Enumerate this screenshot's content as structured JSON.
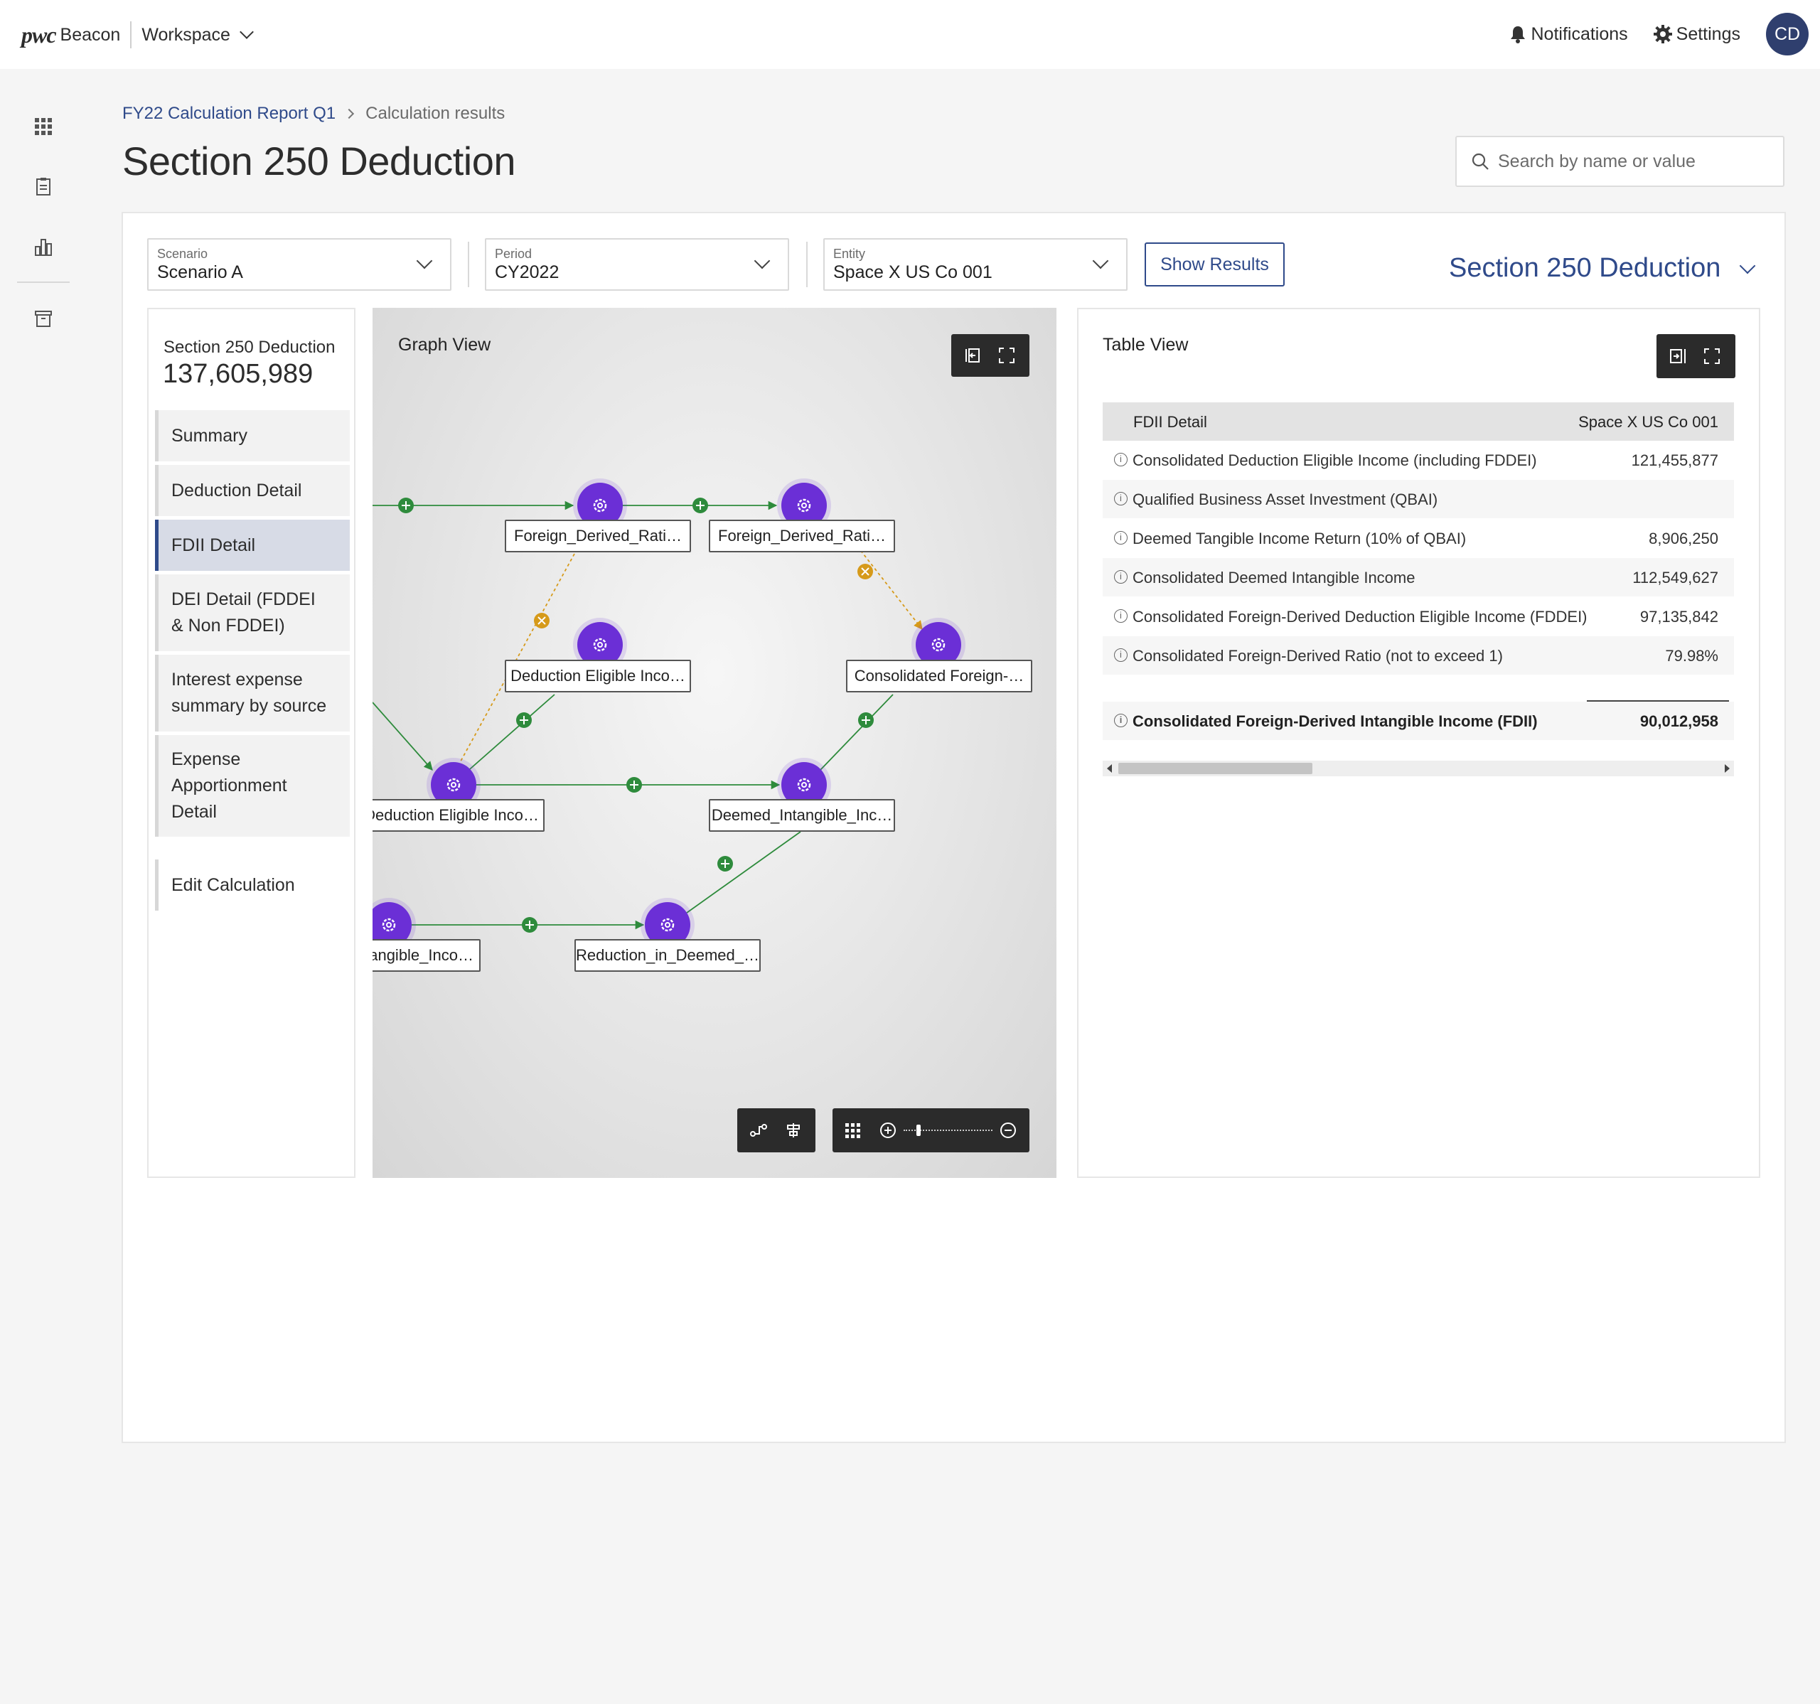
{
  "brand": {
    "logo": "pwc",
    "product": "Beacon",
    "workspace": "Workspace"
  },
  "topnav": {
    "notifications": "Notifications",
    "settings": "Settings",
    "avatar_initials": "CD"
  },
  "breadcrumb": {
    "parent": "FY22 Calculation Report Q1",
    "current": "Calculation results"
  },
  "page_title": "Section 250 Deduction",
  "search": {
    "placeholder": "Search by name or value",
    "value": ""
  },
  "filters": {
    "scenario": {
      "label": "Scenario",
      "value": "Scenario A"
    },
    "period": {
      "label": "Period",
      "value": "CY2022"
    },
    "entity": {
      "label": "Entity",
      "value": "Space X US Co 001"
    },
    "show_results": "Show Results"
  },
  "section_selector": "Section 250 Deduction",
  "nav": {
    "head": "Section 250 Deduction",
    "total": "137,605,989",
    "items": [
      {
        "label": "Summary"
      },
      {
        "label": "Deduction Detail"
      },
      {
        "label": "FDII Detail",
        "active": true
      },
      {
        "label": "DEI Detail (FDDEI & Non FDDEI)"
      },
      {
        "label": "Interest expense summary by source"
      },
      {
        "label": "Expense Apportionment Detail"
      },
      {
        "label": "Edit Calculation"
      }
    ]
  },
  "graph": {
    "title": "Graph View",
    "nodes": [
      {
        "label": "Foreign_Derived_Rati…"
      },
      {
        "label": "Foreign_Derived_Rati…"
      },
      {
        "label": "Deduction Eligible Inco…"
      },
      {
        "label": "Consolidated Foreign-…"
      },
      {
        "label": "Deduction Eligible Inco…"
      },
      {
        "label": "Deemed_Intangible_Inc…"
      },
      {
        "label": "angible_Inco…"
      },
      {
        "label": "Reduction_in_Deemed_…"
      }
    ],
    "zoom_level": 0.15
  },
  "table": {
    "title": "Table View",
    "header": {
      "label": "FDII Detail",
      "column": "Space X US Co 001"
    },
    "rows": [
      {
        "label": "Consolidated Deduction Eligible Income (including FDDEI)",
        "value": "121,455,877"
      },
      {
        "label": "Qualified Business Asset Investment (QBAI)",
        "value": ""
      },
      {
        "label": "Deemed Tangible Income Return (10% of QBAI)",
        "value": "8,906,250"
      },
      {
        "label": "Consolidated Deemed Intangible Income",
        "value": "112,549,627"
      },
      {
        "label": "Consolidated Foreign-Derived Deduction Eligible Income (FDDEI)",
        "value": "97,135,842"
      },
      {
        "label": "Consolidated Foreign-Derived  Ratio (not to exceed 1)",
        "value": "79.98%"
      }
    ],
    "total": {
      "label": "Consolidated Foreign-Derived Intangible Income (FDII)",
      "value": "90,012,958"
    },
    "scroll_position": 0.0
  },
  "colors": {
    "accent": "#2f4a8a",
    "node": "#6b2fd6",
    "edge_green": "#2e8b3c",
    "edge_amber": "#d69a1a"
  }
}
